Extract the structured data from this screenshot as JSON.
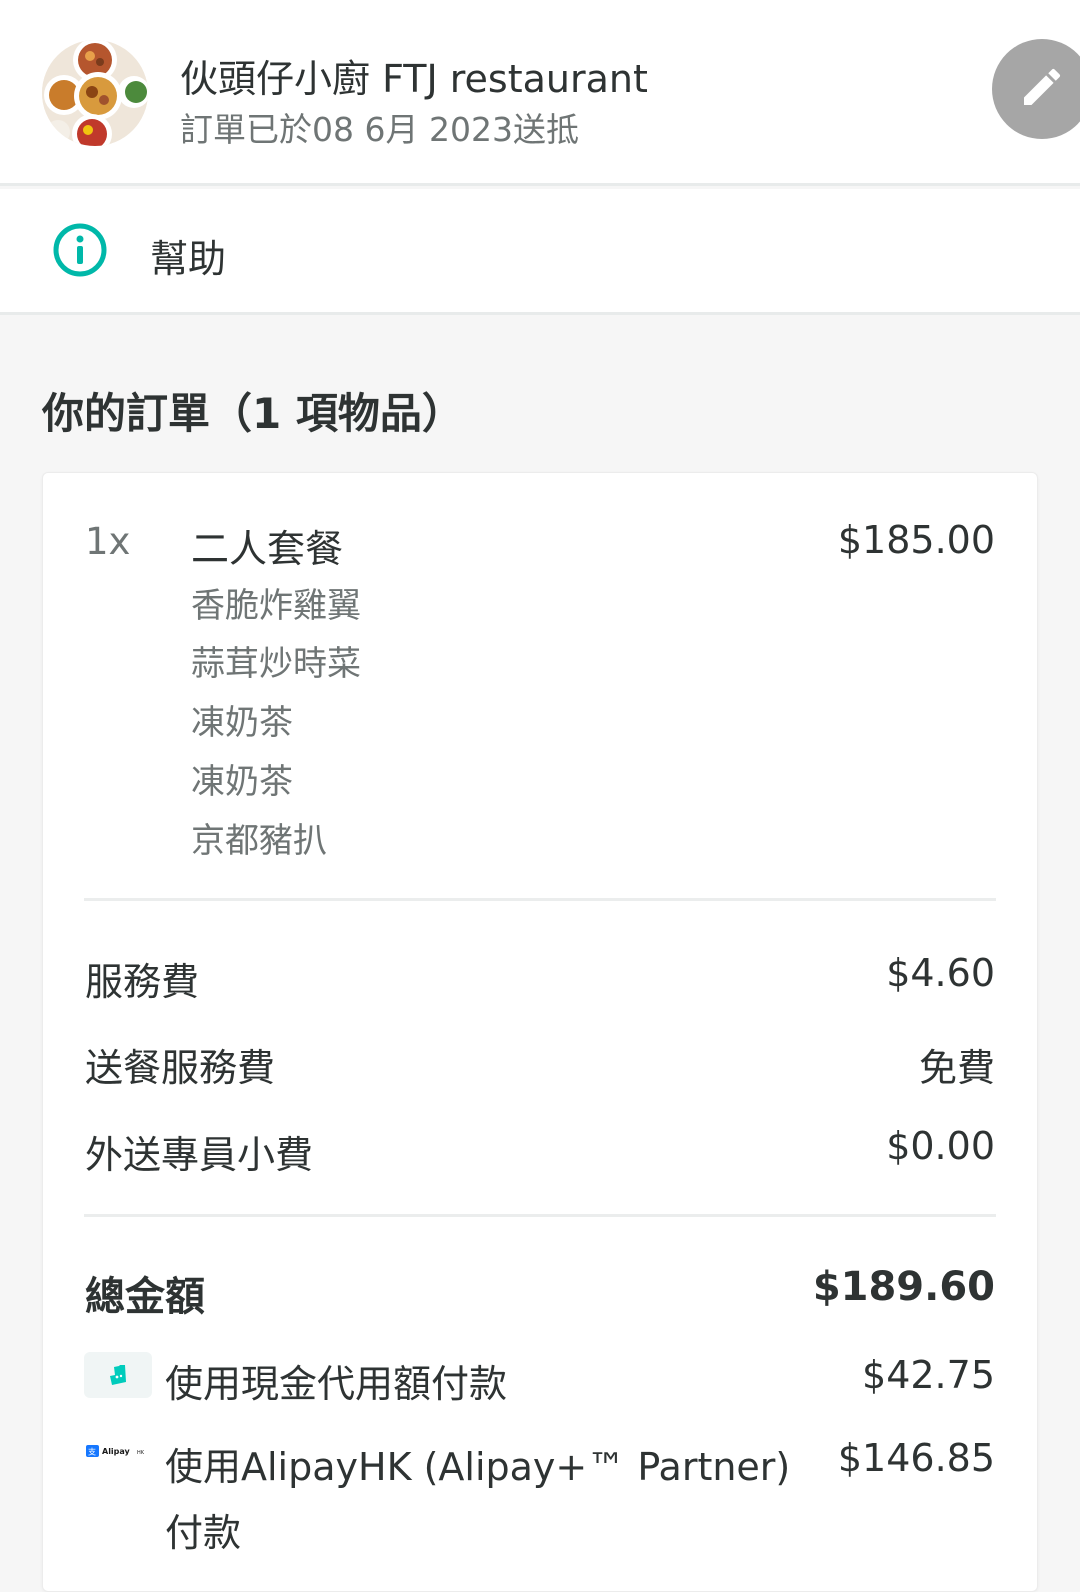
{
  "header": {
    "restaurant_name": "伙頭仔小廚 FTJ restaurant",
    "delivered_text": "訂單已於08 6月 2023送抵",
    "edit_icon": "pencil-icon"
  },
  "help": {
    "label": "幫助",
    "icon": "info-icon",
    "icon_color": "#00b8a9"
  },
  "order": {
    "title": "你的訂單（1 項物品）",
    "items": [
      {
        "qty": "1x",
        "name": "二人套餐",
        "price": "$185.00",
        "modifiers": [
          "香脆炸雞翼",
          "蒜茸炒時菜",
          "凍奶茶",
          "凍奶茶",
          "京都豬扒"
        ]
      }
    ],
    "fees": [
      {
        "label": "服務費",
        "value": "$4.60"
      },
      {
        "label": "送餐服務費",
        "value": "免費"
      },
      {
        "label": "外送專員小費",
        "value": "$0.00"
      }
    ],
    "total": {
      "label": "總金額",
      "value": "$189.60"
    },
    "payments": [
      {
        "label": "使用現金代用額付款",
        "value": "$42.75",
        "icon": "deliveroo-icon"
      },
      {
        "label_line1": "使用AlipayHK (Alipay+™ Partner)",
        "label_line2": "付款",
        "value": "$146.85",
        "icon": "alipay-icon",
        "icon_text": "Alipay",
        "icon_suffix": "HK"
      }
    ]
  },
  "colors": {
    "accent": "#00b8a9",
    "text_primary": "#2e3333",
    "text_secondary": "#6f7575",
    "edit_button": "#a6a6a6"
  }
}
